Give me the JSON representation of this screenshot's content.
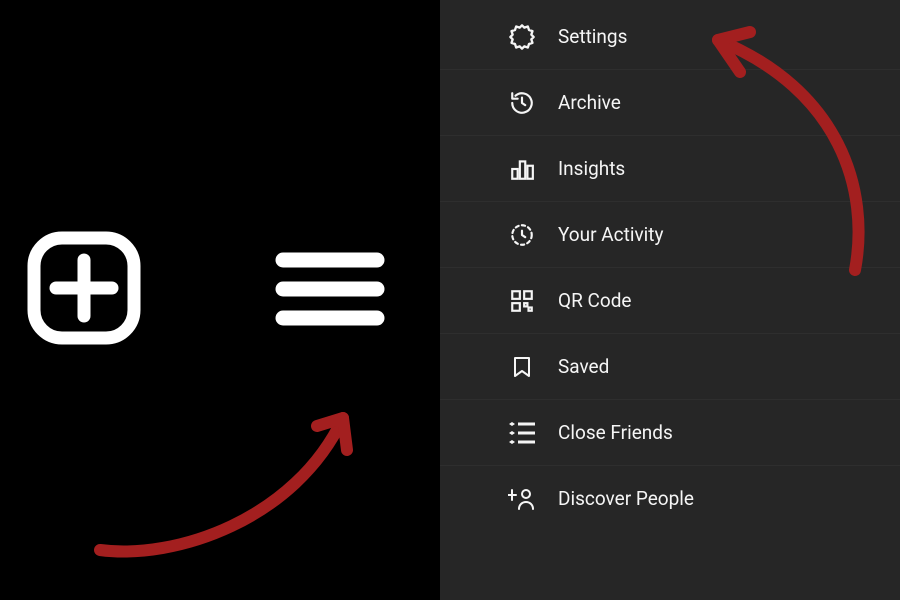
{
  "annotation_color": "#b32424",
  "leftPane": {
    "createIconName": "create-post-icon",
    "hamburgerIconName": "hamburger-menu-icon"
  },
  "menu": {
    "items": [
      {
        "icon": "settings-icon",
        "label": "Settings"
      },
      {
        "icon": "archive-icon",
        "label": "Archive"
      },
      {
        "icon": "insights-icon",
        "label": "Insights"
      },
      {
        "icon": "your-activity-icon",
        "label": "Your Activity"
      },
      {
        "icon": "qr-code-icon",
        "label": "QR Code"
      },
      {
        "icon": "saved-icon",
        "label": "Saved"
      },
      {
        "icon": "close-friends-icon",
        "label": "Close Friends"
      },
      {
        "icon": "discover-people-icon",
        "label": "Discover People"
      }
    ]
  }
}
